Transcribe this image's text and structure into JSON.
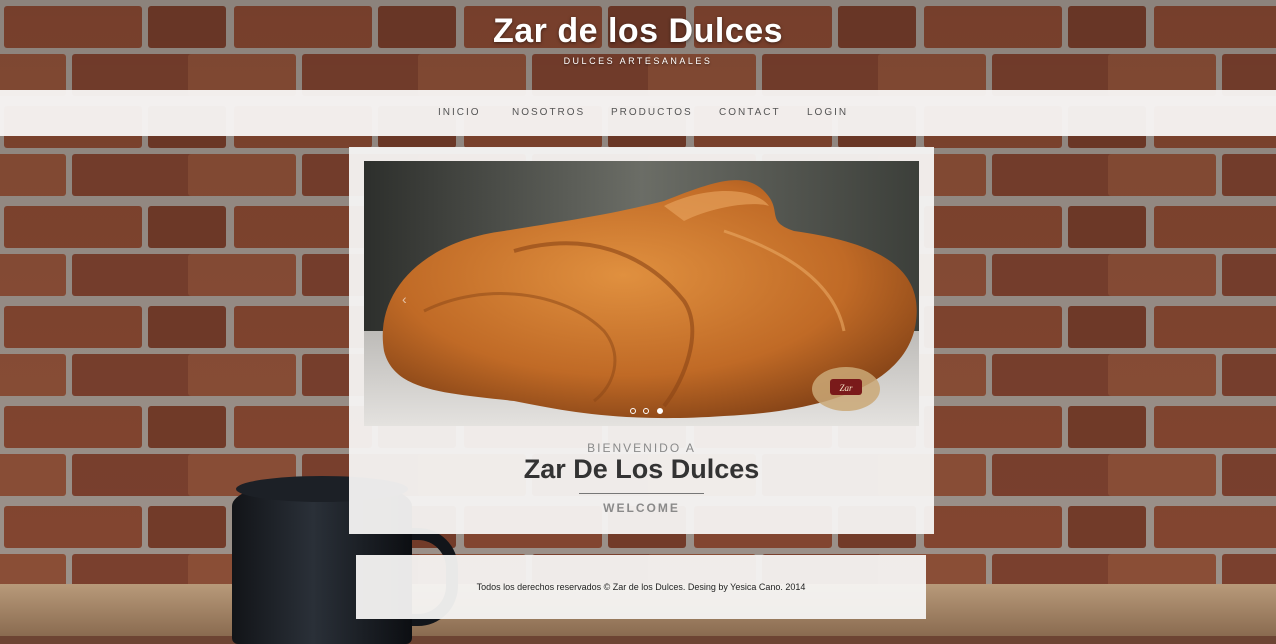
{
  "header": {
    "site_title": "Zar de los Dulces",
    "tagline": "DULCES ARTESANALES"
  },
  "nav": {
    "items": [
      {
        "label": "INICIO"
      },
      {
        "label": "NOSOTROS"
      },
      {
        "label": "PRODUCTOS"
      },
      {
        "label": "CONTACT"
      },
      {
        "label": "LOGIN"
      }
    ]
  },
  "carousel": {
    "prev_arrow": "‹",
    "slide_count": 3,
    "active_slide": 3,
    "logo_text": "Zar"
  },
  "welcome": {
    "pre_heading": "BIENVENIDO A",
    "title": "Zar De Los Dulces",
    "subheading": "WELCOME"
  },
  "footer": {
    "text": "Todos los derechos reservados © Zar de los Dulces. Desing by Yesica Cano. 2014"
  },
  "colors": {
    "brick": "#8a4a33",
    "mortar": "#b7aea6",
    "caramel": "#c8742e",
    "panel": "#f6f4f3"
  }
}
